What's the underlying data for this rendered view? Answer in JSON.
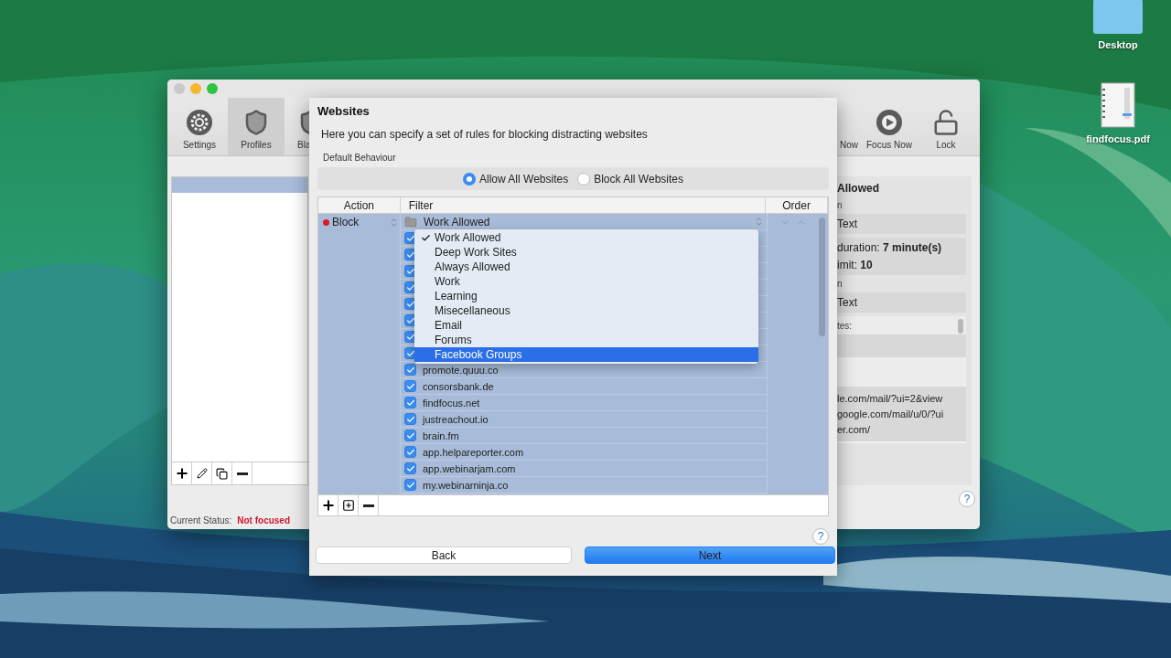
{
  "desktop": {
    "icons": [
      {
        "label": "Desktop",
        "kind": "folder"
      },
      {
        "label": "findfocus.pdf",
        "kind": "document"
      }
    ]
  },
  "main_window": {
    "toolbar": {
      "left": [
        {
          "label": "Settings",
          "kind": "gear",
          "selected": false
        },
        {
          "label": "Profiles",
          "kind": "shield",
          "selected": true
        },
        {
          "label": "Bla",
          "kind": "shield",
          "selected": false
        }
      ],
      "right": [
        {
          "label": "Now",
          "kind": "none",
          "selected": false
        },
        {
          "label": "Focus Now",
          "kind": "play",
          "selected": false
        },
        {
          "label": "Lock",
          "kind": "lock",
          "selected": false
        }
      ]
    },
    "profile_list": {
      "rows": [
        {
          "selected": true
        }
      ]
    },
    "summary": {
      "items": [
        {
          "kind": "heading",
          "text": "Allowed"
        },
        {
          "kind": "label",
          "text": "n"
        },
        {
          "kind": "box",
          "lines": [
            "Text"
          ]
        },
        {
          "kind": "box",
          "lines": [
            "duration: **7 minute(s)**",
            "imit: **10**"
          ]
        },
        {
          "kind": "label",
          "text": "n"
        },
        {
          "kind": "box",
          "lines": [
            "Text"
          ]
        }
      ],
      "sites": {
        "label": "tes:",
        "urls": [
          "le.com/mail/?ui=2&view",
          "google.com/mail/u/0/?ui",
          "er.com/"
        ]
      }
    },
    "help": "?",
    "status": {
      "label": "Current Status:",
      "value": "Not focused"
    }
  },
  "sheet": {
    "title": "Websites",
    "description": "Here you can specify a set of rules for blocking distracting websites",
    "default_behaviour": {
      "label": "Default Behaviour",
      "options": [
        {
          "label": "Allow All Websites",
          "selected": true
        },
        {
          "label": "Block All Websites",
          "selected": false
        }
      ]
    },
    "table": {
      "columns": [
        "Action",
        "Filter",
        "Order"
      ],
      "group": {
        "action": "Block",
        "filter": "Work Allowed",
        "selected": true
      },
      "rows": [
        {
          "checked": true
        },
        {
          "checked": true
        },
        {
          "checked": true
        },
        {
          "checked": true
        },
        {
          "checked": true
        },
        {
          "checked": true
        },
        {
          "checked": true
        },
        {
          "checked": true
        },
        {
          "site": "promote.quuu.co",
          "checked": true
        },
        {
          "site": "consorsbank.de",
          "checked": true
        },
        {
          "site": "findfocus.net",
          "checked": true
        },
        {
          "site": "justreachout.io",
          "checked": true
        },
        {
          "site": "brain.fm",
          "checked": true
        },
        {
          "site": "app.helpareporter.com",
          "checked": true
        },
        {
          "site": "app.webinarjam.com",
          "checked": true
        },
        {
          "site": "my.webinarninja.co",
          "checked": true
        }
      ]
    },
    "menu": {
      "items": [
        {
          "label": "Work Allowed",
          "checked": true,
          "selected": false
        },
        {
          "label": "Deep Work Sites",
          "checked": false,
          "selected": false
        },
        {
          "label": "Always Allowed",
          "checked": false,
          "selected": false
        },
        {
          "label": "Work",
          "checked": false,
          "selected": false
        },
        {
          "label": "Learning",
          "checked": false,
          "selected": false
        },
        {
          "label": "Misecellaneous",
          "checked": false,
          "selected": false
        },
        {
          "label": "Email",
          "checked": false,
          "selected": false
        },
        {
          "label": "Forums",
          "checked": false,
          "selected": false
        },
        {
          "label": "Facebook Groups",
          "checked": false,
          "selected": true
        }
      ]
    },
    "help": "?",
    "buttons": [
      {
        "label": "Back",
        "kind": "default"
      },
      {
        "label": "Next",
        "kind": "primary"
      }
    ]
  }
}
